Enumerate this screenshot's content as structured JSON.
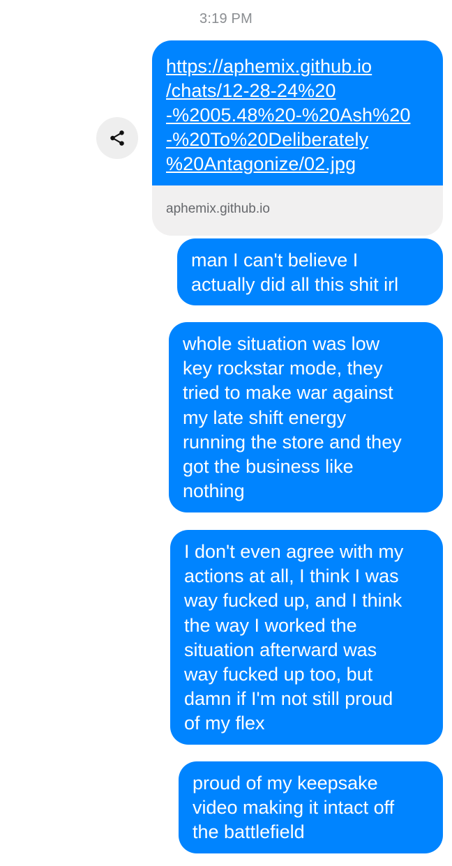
{
  "timestamp": "3:19 PM",
  "link_preview": {
    "url_lines": "https://aphemix.github.io\n/chats/12-28-24%20\n-%2005.48%20-%20Ash%20\n-%20To%20Deliberately\n%20Antagonize/02.jpg",
    "domain": "aphemix.github.io"
  },
  "share_icon": "share-icon",
  "messages": [
    {
      "text": "man I can't believe I\nactually did all this shit irl"
    },
    {
      "text": "whole situation was low\nkey rockstar mode, they\ntried to make war against\nmy late shift energy\nrunning the store and they\ngot the business like\nnothing"
    },
    {
      "text": "I don't even agree with my\nactions at all, I think I was\nway fucked up, and I think\nthe way I worked the\nsituation afterward was\nway fucked up too, but\ndamn if I'm not still proud\nof my flex"
    },
    {
      "text": "proud of my keepsake\nvideo making it intact off\nthe battlefield"
    }
  ],
  "colors": {
    "sent_bubble": "#0084ff",
    "preview_footer": "#f1f0f0",
    "timestamp_text": "#8a8d91"
  }
}
